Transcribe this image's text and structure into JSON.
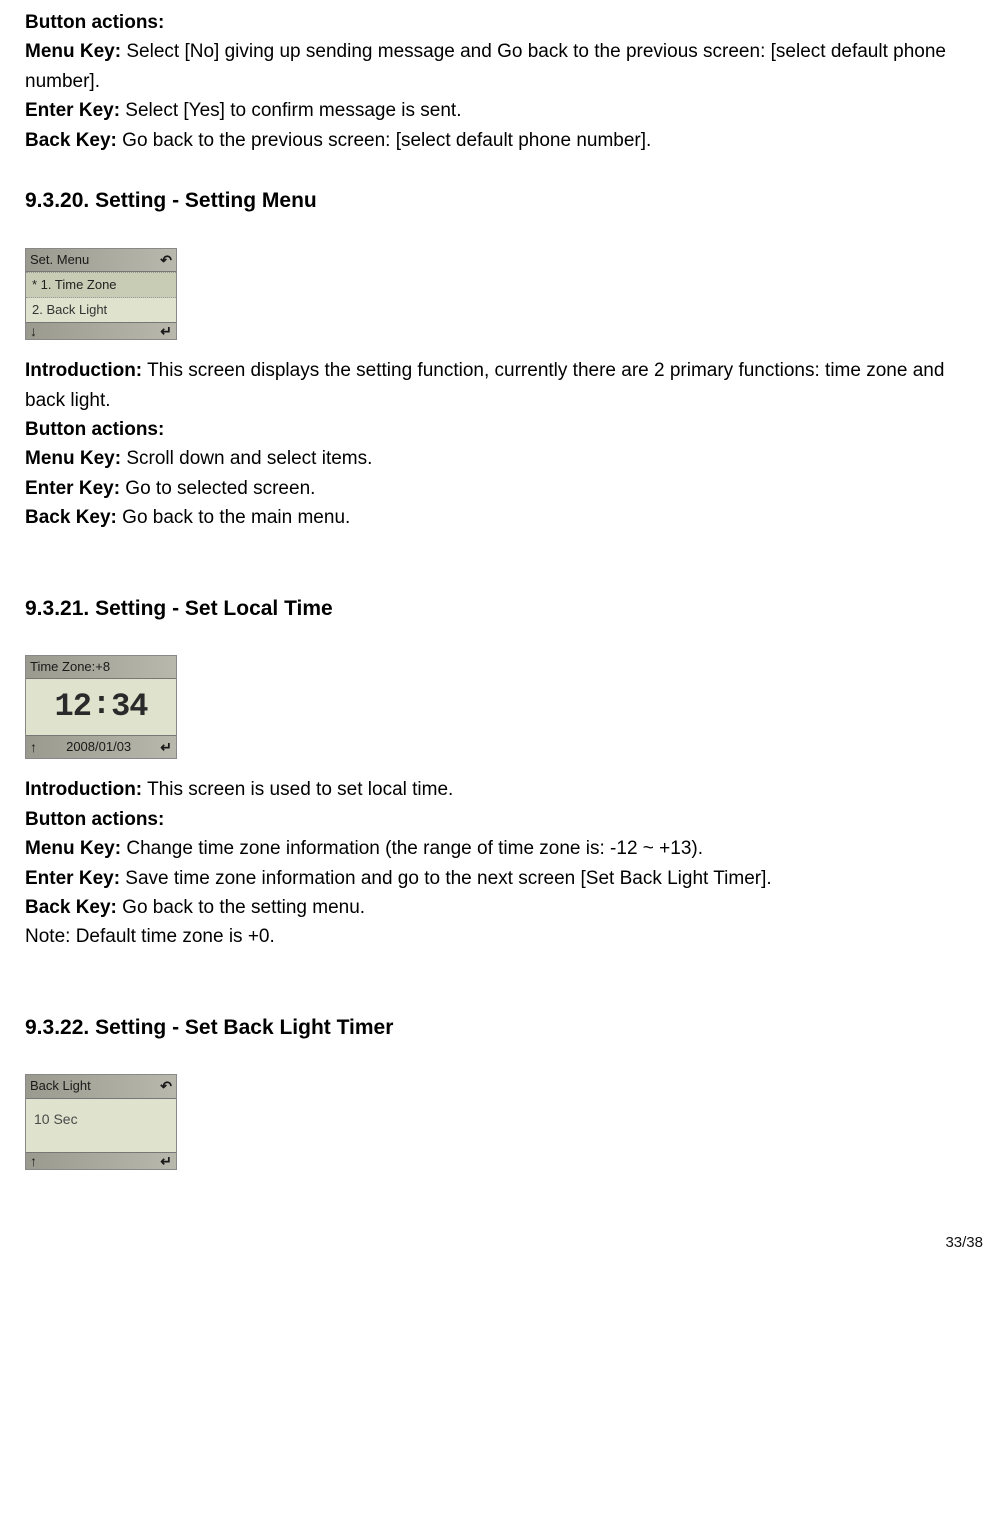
{
  "section_top": {
    "button_actions_label": "Button actions:",
    "menu_key_label": "Menu Key:",
    "menu_key_text": " Select [No] giving up sending message and Go back to the previous screen: [select default phone number].",
    "enter_key_label": "Enter Key:",
    "enter_key_text": " Select [Yes] to confirm message is sent.",
    "back_key_label": "Back Key:",
    "back_key_text": " Go back to the previous screen: [select default phone number]."
  },
  "s9320": {
    "number": "9.3.20.",
    "title": "Setting - Setting Menu",
    "screen": {
      "title": "Set. Menu",
      "back_icon": "↶",
      "item1": "* 1. Time Zone",
      "item2": "  2. Back Light",
      "down_icon": "↓",
      "enter_icon": "↵"
    },
    "intro_label": "Introduction:",
    "intro_text": " This screen displays the setting function, currently there are 2 primary functions: time zone and back light.",
    "button_actions_label": "Button actions:",
    "menu_key_label": "Menu Key:",
    "menu_key_text": " Scroll down and select items.",
    "enter_key_label": "Enter Key:",
    "enter_key_text": " Go to selected screen.",
    "back_key_label": "Back Key:",
    "back_key_text": " Go back to the main menu."
  },
  "s9321": {
    "number": "9.3.21.",
    "title": "Setting - Set Local Time",
    "screen": {
      "title": "Time Zone:+8",
      "time": "12:34",
      "date": "2008/01/03",
      "up_icon": "↑",
      "enter_icon": "↵"
    },
    "intro_label": "Introduction:",
    "intro_text": " This screen is used to set local time.",
    "button_actions_label": "Button actions:",
    "menu_key_label": "Menu Key:",
    "menu_key_text": " Change time zone information (the range of time zone is: -12 ~ +13).",
    "enter_key_label": "Enter Key:",
    "enter_key_text": " Save time zone information and go to the next screen [Set Back Light Timer].",
    "back_key_label": "Back Key:",
    "back_key_text": " Go back to the setting menu.",
    "note_text": "Note: Default time zone is +0."
  },
  "s9322": {
    "number": "9.3.22.",
    "title": "Setting - Set Back Light Timer",
    "screen": {
      "title": "Back Light",
      "back_icon": "↶",
      "value": "10 Sec",
      "up_icon": "↑",
      "enter_icon": "↵"
    }
  },
  "page_number": "33/38"
}
